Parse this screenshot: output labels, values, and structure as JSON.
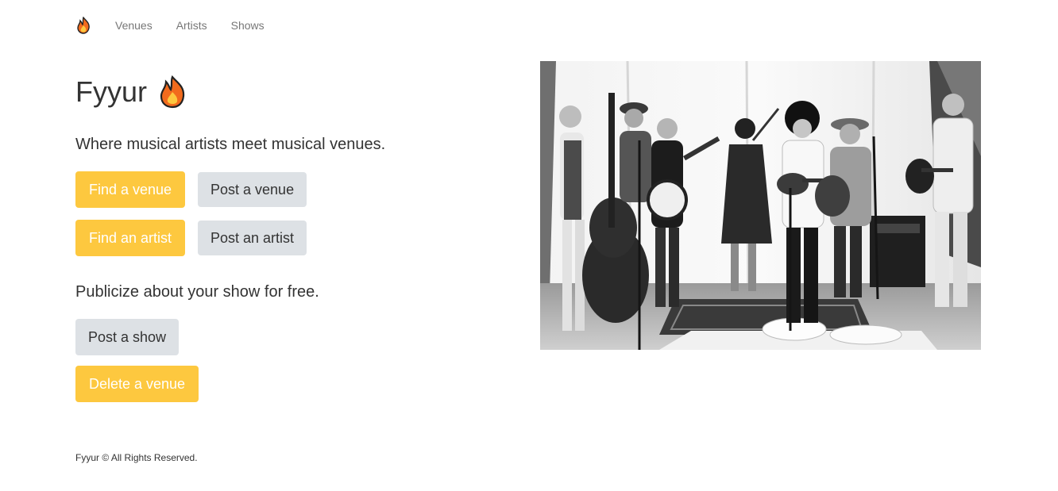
{
  "nav": {
    "brand_icon": "flame-icon",
    "items": [
      {
        "label": "Venues"
      },
      {
        "label": "Artists"
      },
      {
        "label": "Shows"
      }
    ]
  },
  "hero": {
    "title": "Fyyur",
    "title_icon": "flame-icon",
    "tagline": "Where musical artists meet musical venues.",
    "tagline2": "Publicize about your show for free."
  },
  "buttons": {
    "find_venue": "Find a venue",
    "post_venue": "Post a venue",
    "find_artist": "Find an artist",
    "post_artist": "Post an artist",
    "post_show": "Post a show",
    "delete_venue": "Delete a venue"
  },
  "footer": {
    "text": "Fyyur © All Rights Reserved."
  },
  "colors": {
    "warning": "#fdc83f",
    "default": "#dde1e5",
    "nav_text": "#777777",
    "text": "#333333"
  }
}
